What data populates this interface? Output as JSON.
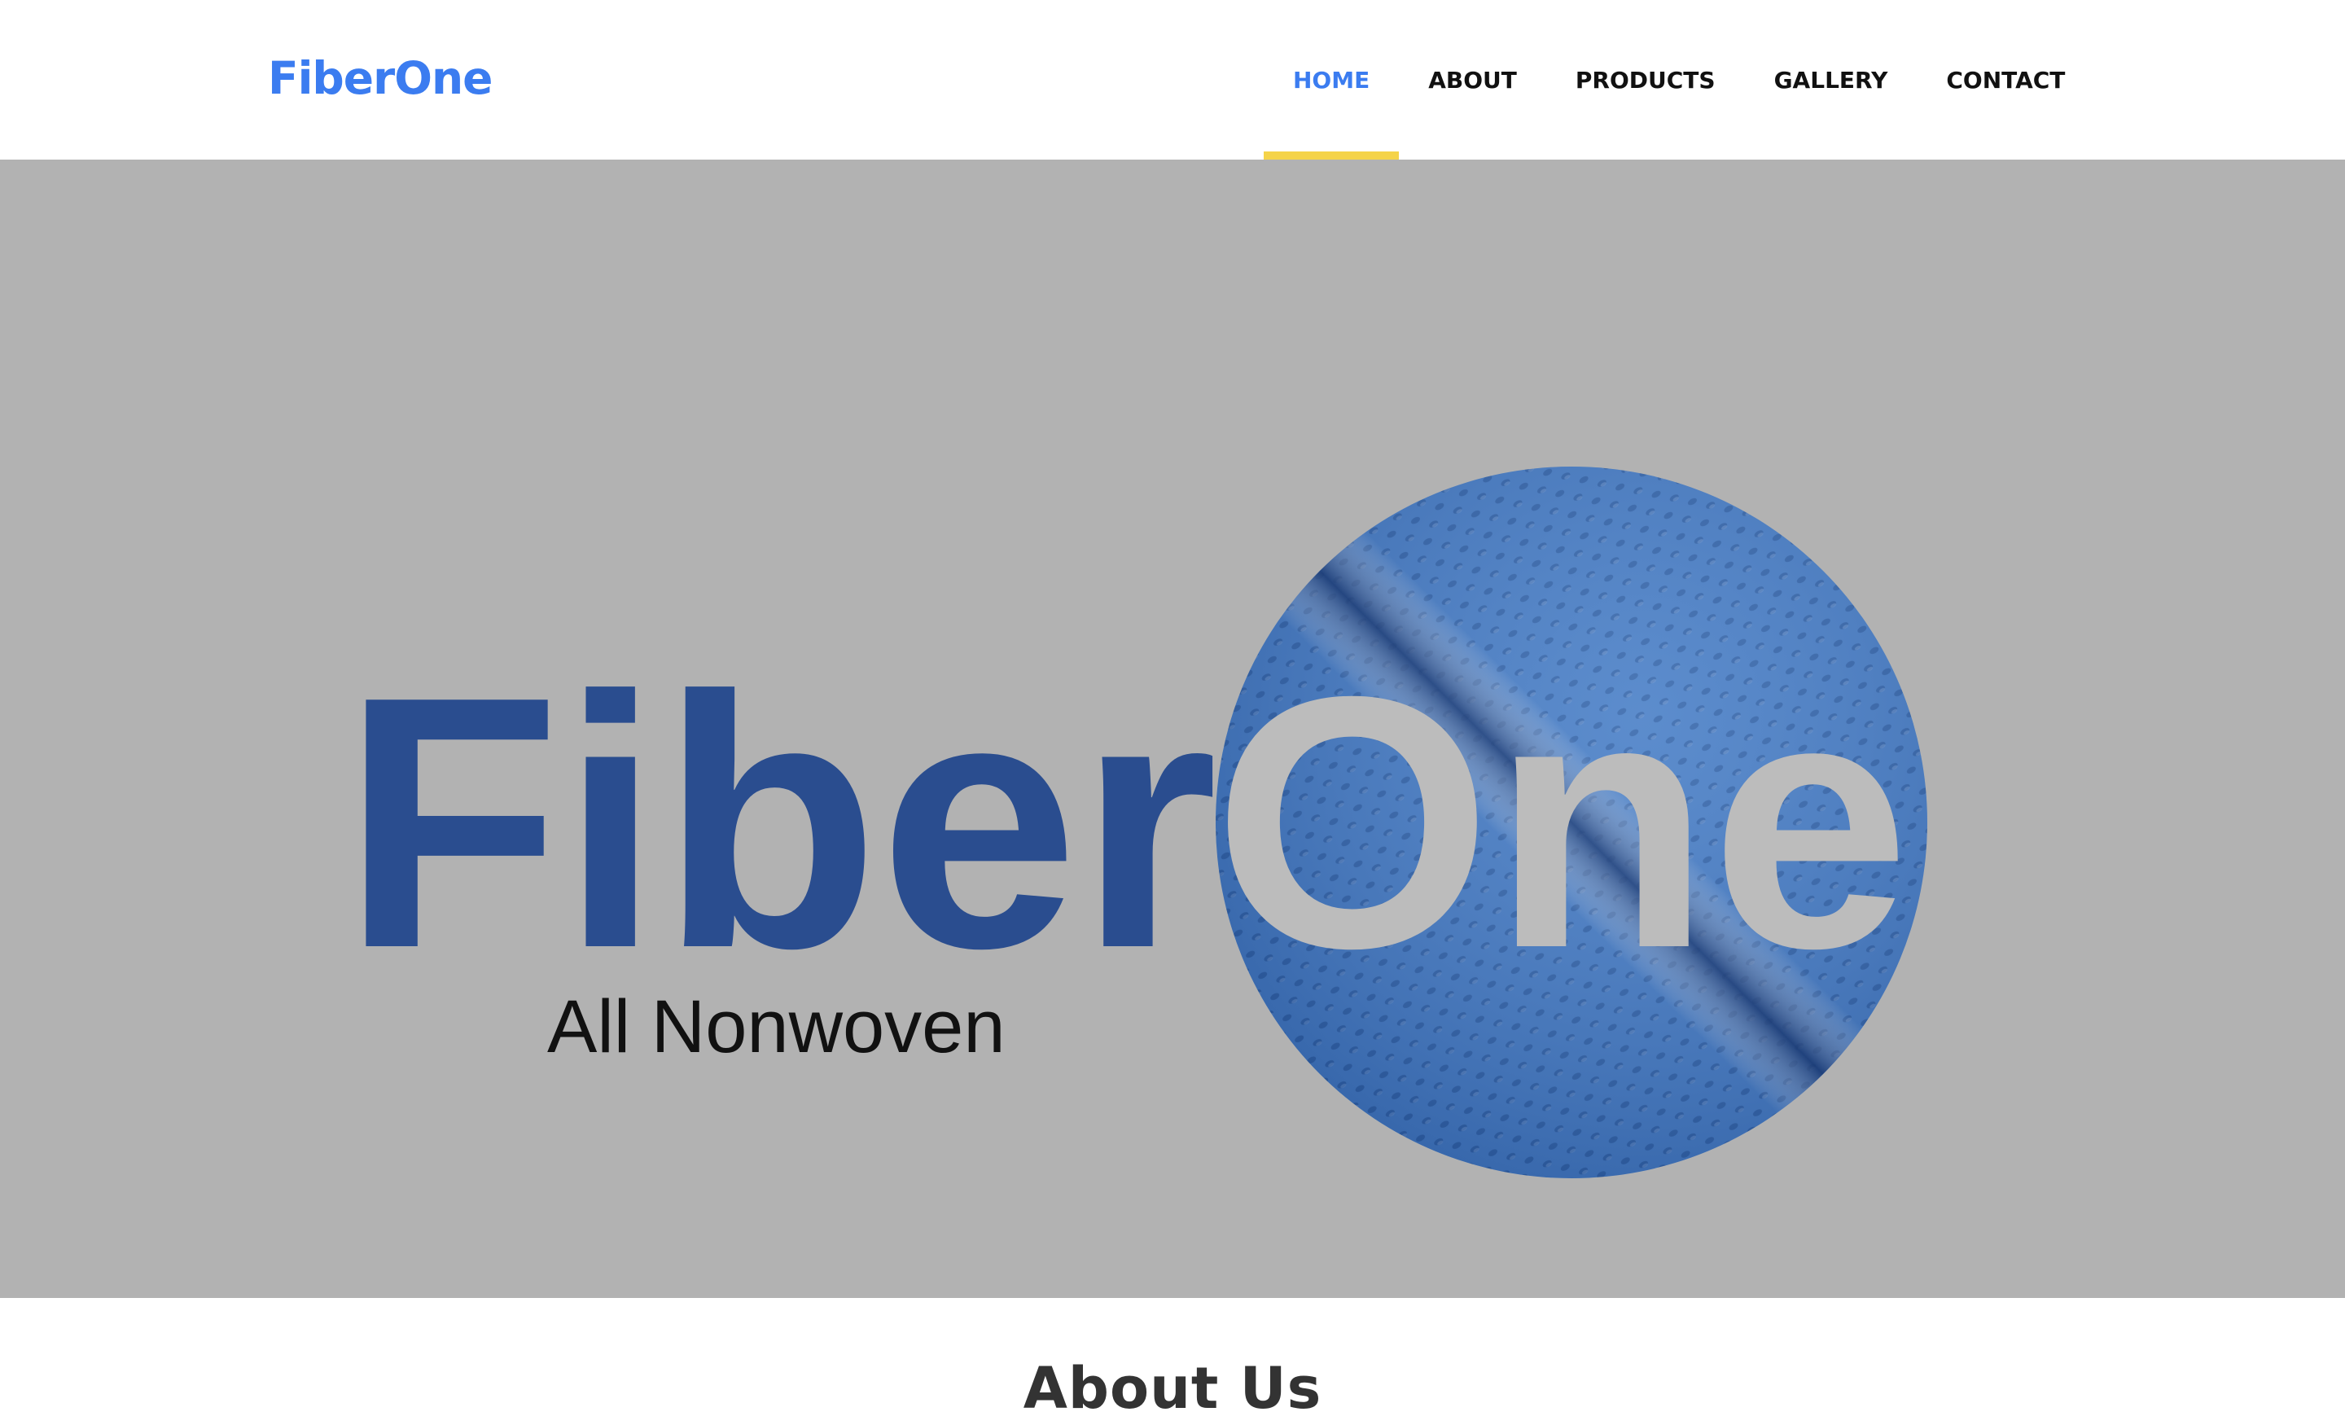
{
  "header": {
    "brand": "FiberOne",
    "nav": [
      {
        "label": "HOME",
        "active": true
      },
      {
        "label": "ABOUT",
        "active": false
      },
      {
        "label": "PRODUCTS",
        "active": false
      },
      {
        "label": "GALLERY",
        "active": false
      },
      {
        "label": "CONTACT",
        "active": false
      }
    ]
  },
  "hero": {
    "logo_word_1": "Fiber",
    "logo_word_2": "One",
    "tagline": "All Nonwoven"
  },
  "about": {
    "title": "About Us"
  },
  "colors": {
    "brand_blue": "#3b7cf0",
    "logo_navy": "#2a4d8f",
    "active_underline": "#f5d349",
    "hero_background": "#b2b2b2",
    "fabric_blue": "#3f78c4"
  },
  "icons": [
    "fabric-circle-image"
  ]
}
